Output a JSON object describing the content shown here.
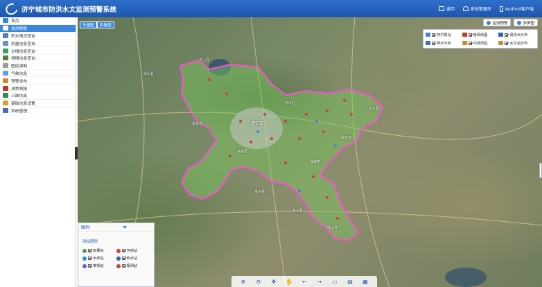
{
  "header": {
    "title": "济宁城市防洪水文监测预警系统",
    "actions": {
      "back": "返回",
      "admin": "系统管理员",
      "android": "Android客户端"
    }
  },
  "sidebar": {
    "items": [
      {
        "label": "首页",
        "color": "#3b86d6"
      },
      {
        "label": "监测预警",
        "color": "#ffffff"
      },
      {
        "label": "积水情况查询",
        "color": "#4a7fc0"
      },
      {
        "label": "雨量信息查询",
        "color": "#6a8fb8"
      },
      {
        "label": "水情信息查询",
        "color": "#3a9c64"
      },
      {
        "label": "墒情信息查询",
        "color": "#5a7a3a"
      },
      {
        "label": "图层调制",
        "color": "#9a9a9a"
      },
      {
        "label": "气象信息",
        "color": "#5aa0e0"
      },
      {
        "label": "预警发布",
        "color": "#d08a2a"
      },
      {
        "label": "决策预报",
        "color": "#c0392b"
      },
      {
        "label": "三维仿真",
        "color": "#2e8b57"
      },
      {
        "label": "基础信息设置",
        "color": "#e0a030"
      },
      {
        "label": "系统管理",
        "color": "#4a6fa5"
      }
    ]
  },
  "map": {
    "types": {
      "vector": "矢量图",
      "satellite": "影像图"
    },
    "top_buttons": {
      "monitor": "监测预警",
      "multi": "多屏图"
    },
    "layers": [
      {
        "label": "排洪泵站",
        "color": "#3b86d6"
      },
      {
        "label": "管网线图",
        "color": "#c0392b"
      },
      {
        "label": "易涝点分布",
        "color": "#2a64b8"
      },
      {
        "label": "排水分布",
        "color": "#3a6fb8"
      },
      {
        "label": "内涝风险",
        "color": "#d08a2a"
      },
      {
        "label": "水文站分布",
        "color": "#c08a40"
      }
    ],
    "labels": [
      {
        "text": "济宁市"
      },
      {
        "text": "嘉祥县"
      },
      {
        "text": "任城区"
      },
      {
        "text": "兖州区"
      },
      {
        "text": "邹城市"
      },
      {
        "text": "曲阜市"
      },
      {
        "text": "金乡县"
      },
      {
        "text": "汶上县"
      },
      {
        "text": "微山县"
      },
      {
        "text": "鱼台县"
      },
      {
        "text": "泗水县"
      },
      {
        "text": "梁山县"
      }
    ]
  },
  "legend": {
    "title": "图例",
    "subtitle": "测站图例",
    "items": [
      {
        "label": "雨量站",
        "color": "#3a9c64"
      },
      {
        "label": "河道站",
        "color": "#d63a3a"
      },
      {
        "label": "水库站",
        "color": "#3b86d6"
      },
      {
        "label": "积水站",
        "color": "#2a64b8"
      },
      {
        "label": "墒情站",
        "color": "#6a5acd"
      },
      {
        "label": "堰闸站",
        "color": "#d63a3a"
      }
    ]
  },
  "toolbar": {
    "tools": [
      "⊕",
      "⊖",
      "✥",
      "✋",
      "←",
      "→",
      "▭",
      "▤",
      "▦"
    ]
  }
}
